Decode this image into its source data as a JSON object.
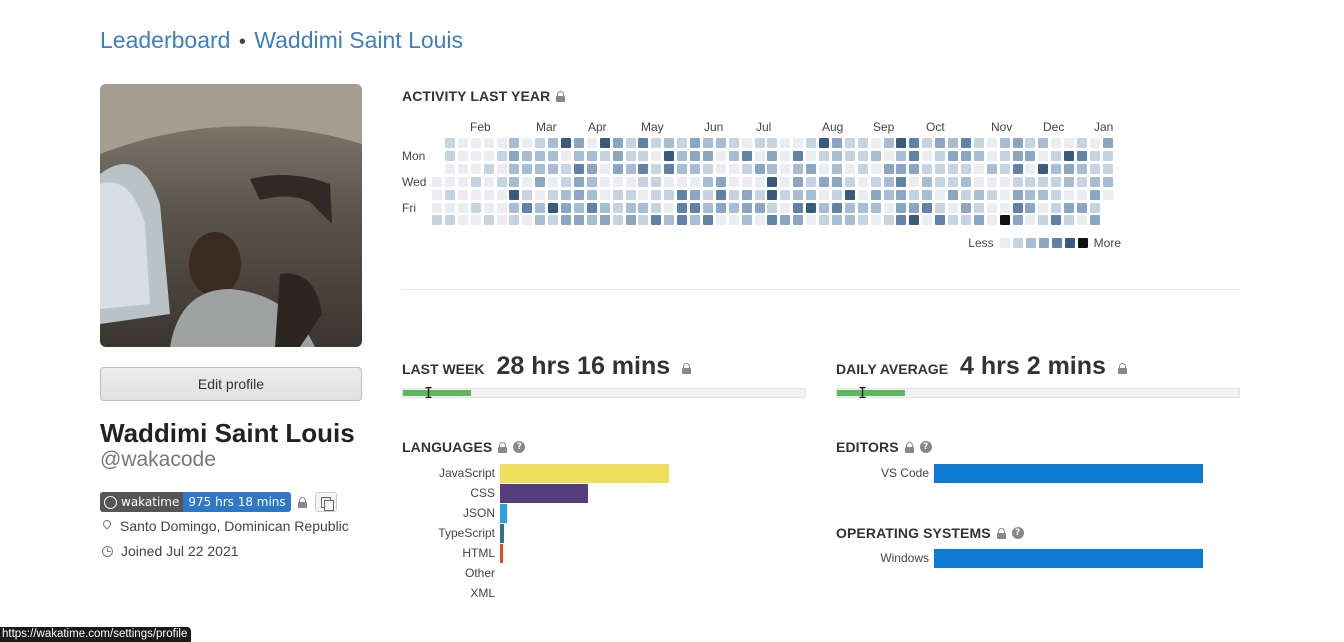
{
  "breadcrumb": {
    "root": "Leaderboard",
    "separator": "•",
    "current": "Waddimi Saint Louis"
  },
  "profile": {
    "edit_label": "Edit profile",
    "name": "Waddimi Saint Louis",
    "username": "@wakacode",
    "badge_label": "wakatime",
    "badge_value": "975 hrs 18 mins",
    "location": "Santo Domingo, Dominican Republic",
    "joined": "Joined Jul 22 2021"
  },
  "activity": {
    "title": "ACTIVITY LAST YEAR",
    "months": [
      "Feb",
      "Mar",
      "Apr",
      "May",
      "Jun",
      "Jul",
      "Aug",
      "Sep",
      "Oct",
      "Nov",
      "Dec",
      "Jan"
    ],
    "day_labels": [
      "Mon",
      "Wed",
      "Fri"
    ],
    "legend_less": "Less",
    "legend_more": "More",
    "colors": [
      "#ebedf0",
      "#c6d4e1",
      "#a7bdd3",
      "#8aa6c2",
      "#5f82a6",
      "#3a5a7d",
      "#111111"
    ]
  },
  "last_week": {
    "label": "LAST WEEK",
    "value": "28 hrs 16 mins",
    "progress": 0.17
  },
  "daily_average": {
    "label": "DAILY AVERAGE",
    "value": "4 hrs 2 mins",
    "progress": 0.17
  },
  "languages": {
    "title": "LANGUAGES",
    "items": [
      {
        "name": "JavaScript",
        "value": 0.42,
        "color": "#f0df5a"
      },
      {
        "name": "CSS",
        "value": 0.22,
        "color": "#563d7c"
      },
      {
        "name": "JSON",
        "value": 0.018,
        "color": "#2f9ee8"
      },
      {
        "name": "TypeScript",
        "value": 0.01,
        "color": "#2b7489"
      },
      {
        "name": "HTML",
        "value": 0.007,
        "color": "#e34c26"
      },
      {
        "name": "Other",
        "value": 0,
        "color": "#999999"
      },
      {
        "name": "XML",
        "value": 0,
        "color": "#999999"
      }
    ]
  },
  "editors": {
    "title": "EDITORS",
    "items": [
      {
        "name": "VS Code",
        "value": 1.0,
        "color": "#0e7ad3"
      }
    ]
  },
  "operating_systems": {
    "title": "OPERATING SYSTEMS",
    "items": [
      {
        "name": "Windows",
        "value": 1.0,
        "color": "#0e7ad3"
      }
    ]
  },
  "status_url": "https://wakatime.com/settings/profile"
}
